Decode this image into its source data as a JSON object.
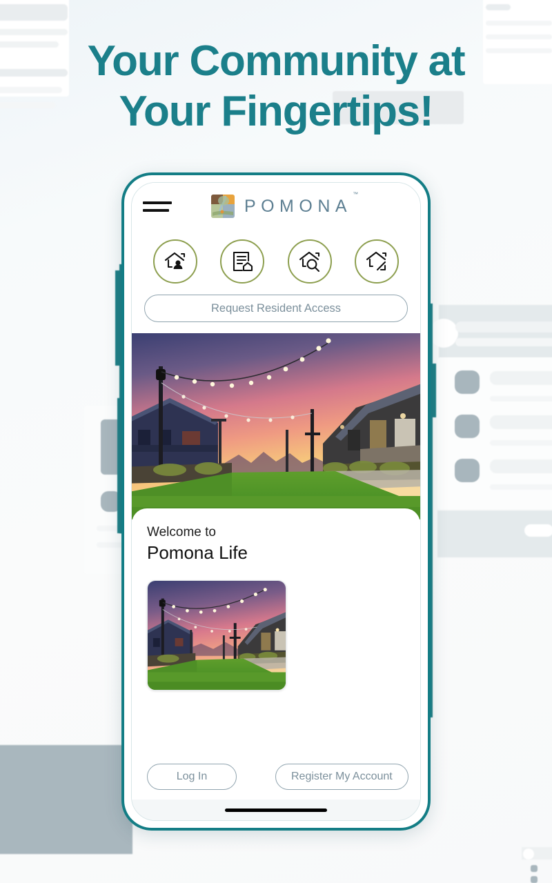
{
  "page": {
    "headline_line1": "Your Community at",
    "headline_line2": "Your Fingertips!",
    "accent_color": "#1b7f8a",
    "olive_color": "#8d9f4f",
    "slate_color": "#7b8f9b"
  },
  "phone": {
    "appbar": {
      "menu_icon": "hamburger-icon",
      "logo_icon": "pomona-logo-mark",
      "logo_text": "POMONA",
      "trademark": "™"
    },
    "quick_actions": [
      {
        "name": "resident-directory",
        "icon": "house-person-icon"
      },
      {
        "name": "documents",
        "icon": "document-house-icon"
      },
      {
        "name": "property-search",
        "icon": "house-search-icon"
      },
      {
        "name": "property-expand",
        "icon": "house-arrow-icon"
      }
    ],
    "request_access_label": "Request Resident Access",
    "hero_image_alt": "community-sunset-lawn",
    "welcome": {
      "greeting": "Welcome to",
      "title": "Pomona Life",
      "thumbnail_alt": "community-sunset-lawn-thumbnail"
    },
    "auth": {
      "login_label": "Log In",
      "register_label": "Register My Account"
    },
    "home_indicator": "home-indicator-bar"
  }
}
